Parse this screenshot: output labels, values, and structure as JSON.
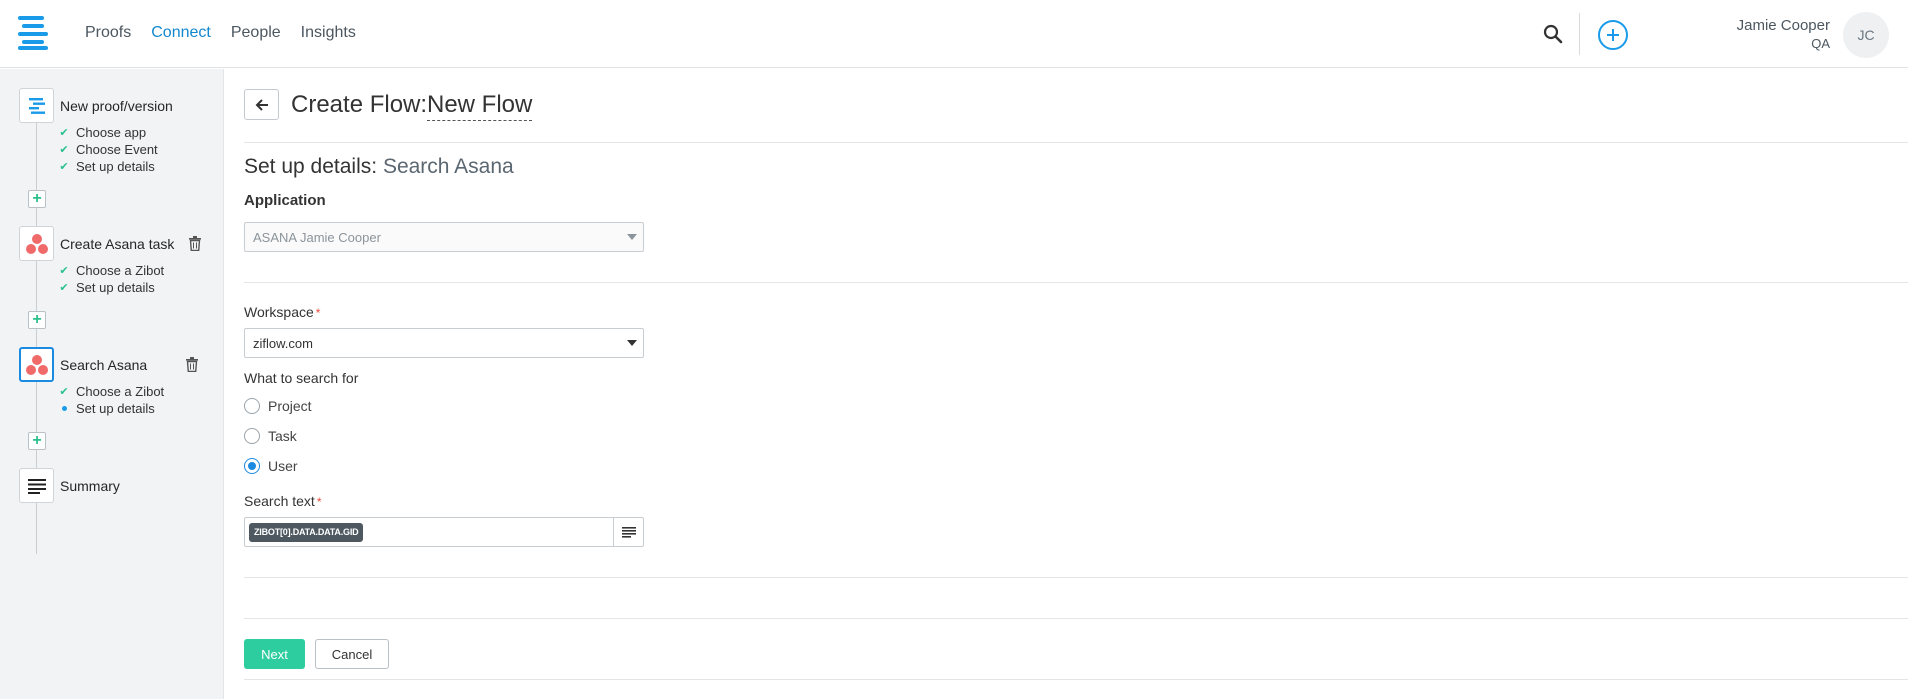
{
  "header": {
    "nav": [
      "Proofs",
      "Connect",
      "People",
      "Insights"
    ],
    "active_nav": "Connect",
    "user_name": "Jamie Cooper",
    "user_role": "QA",
    "avatar_initials": "JC"
  },
  "sidebar": {
    "steps": [
      {
        "label": "New proof/version",
        "icon": "ziflow-list-icon",
        "subs": [
          {
            "label": "Choose app",
            "state": "done"
          },
          {
            "label": "Choose Event",
            "state": "done"
          },
          {
            "label": "Set up details",
            "state": "done"
          }
        ]
      },
      {
        "label": "Create Asana task",
        "icon": "asana-icon",
        "subs": [
          {
            "label": "Choose a Zibot",
            "state": "done"
          },
          {
            "label": "Set up details",
            "state": "done"
          }
        ]
      },
      {
        "label": "Search Asana",
        "icon": "asana-icon",
        "subs": [
          {
            "label": "Choose a Zibot",
            "state": "done"
          },
          {
            "label": "Set up details",
            "state": "current"
          }
        ]
      },
      {
        "label": "Summary",
        "icon": "summary-icon",
        "subs": []
      }
    ]
  },
  "main": {
    "title_prefix": "Create Flow:",
    "title_name": "New Flow",
    "section_prefix": "Set up details:",
    "section_name": "Search Asana",
    "application_label": "Application",
    "application_value": "ASANA Jamie Cooper",
    "workspace_label": "Workspace",
    "workspace_value": "ziflow.com",
    "search_for_label": "What to search for",
    "search_options": [
      "Project",
      "Task",
      "User"
    ],
    "search_selected": "User",
    "search_text_label": "Search text",
    "search_text_token": "ZIBOT[0].DATA.DATA.GID",
    "required_mark": "*",
    "next_label": "Next",
    "cancel_label": "Cancel"
  },
  "colors": {
    "brand": "#1a9be9",
    "success": "#2dcda0",
    "asana": "#f06a6a"
  }
}
